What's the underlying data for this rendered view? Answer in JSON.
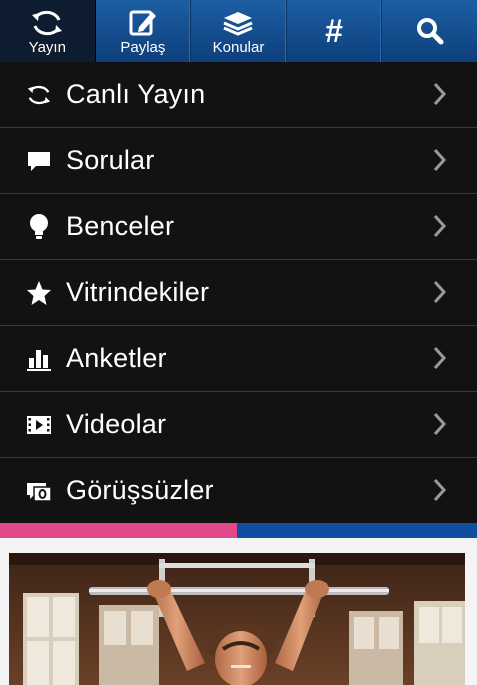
{
  "tabs": [
    {
      "name": "tab-yayin",
      "label": "Yayın",
      "icon": "refresh-icon",
      "active": true
    },
    {
      "name": "tab-paylas",
      "label": "Paylaş",
      "icon": "edit-icon",
      "active": false
    },
    {
      "name": "tab-konular",
      "label": "Konular",
      "icon": "books-icon",
      "active": false
    },
    {
      "name": "tab-hashtag",
      "label": "#",
      "icon": "hashtag-icon",
      "active": false
    },
    {
      "name": "tab-search",
      "label": "",
      "icon": "search-icon",
      "active": false
    }
  ],
  "menu": {
    "items": [
      {
        "label": "Canlı Yayın",
        "icon": "refresh-icon"
      },
      {
        "label": "Sorular",
        "icon": "speech-bubble-icon"
      },
      {
        "label": "Benceler",
        "icon": "lightbulb-icon"
      },
      {
        "label": "Vitrindekiler",
        "icon": "star-icon"
      },
      {
        "label": "Anketler",
        "icon": "bar-chart-icon"
      },
      {
        "label": "Videolar",
        "icon": "video-icon"
      },
      {
        "label": "Görüşsüzler",
        "icon": "chat-zero-icon"
      }
    ]
  },
  "colors": {
    "topbar": "#1a5aa0",
    "tab_active": "#0d1c2e",
    "menu_bg": "#121212",
    "stripe_pink": "#e3488a",
    "stripe_blue": "#114ea0"
  },
  "photo": {
    "icon": "fitness-photo"
  }
}
